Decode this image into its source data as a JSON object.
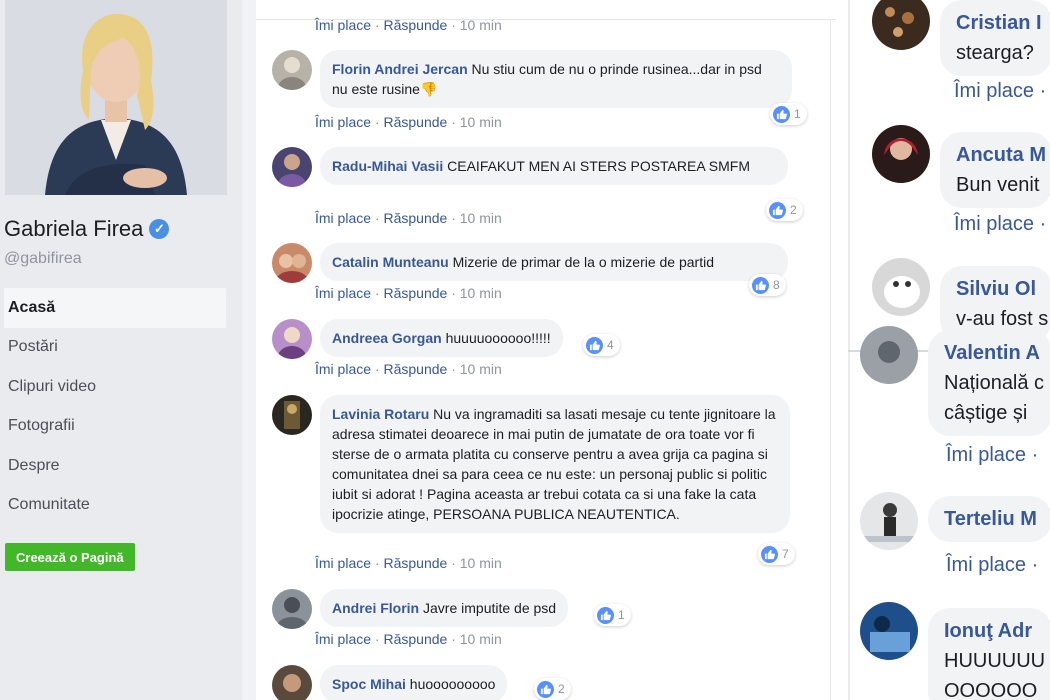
{
  "profile": {
    "name": "Gabriela Firea",
    "handle": "@gabifirea"
  },
  "nav": [
    {
      "label": "Acasă",
      "active": true
    },
    {
      "label": "Postări"
    },
    {
      "label": "Clipuri video"
    },
    {
      "label": "Fotografii"
    },
    {
      "label": "Despre"
    },
    {
      "label": "Comunitate"
    }
  ],
  "create_page_label": "Creează o Pagină",
  "actions": {
    "like": "Îmi place",
    "reply": "Răspunde",
    "sep": " · "
  },
  "top_action": {
    "time": "10 min"
  },
  "comments": [
    {
      "author": "Florin Andrei Jercan",
      "text": "Nu stiu cum de nu o prinde rusinea...dar in psd nu este rusine",
      "emoji": "👎",
      "time": "10 min",
      "likes": "1"
    },
    {
      "author": "Radu-Mihai Vasii",
      "text": "CEAIFAKUT MEN AI STERS POSTAREA SMFM",
      "time": "10 min",
      "likes": "2"
    },
    {
      "author": "Catalin Munteanu",
      "text": "Mizerie de primar de la o mizerie de partid",
      "time": "10 min",
      "likes": "8"
    },
    {
      "author": "Andreea Gorgan",
      "text": "huuuuoooooo!!!!!",
      "time": "10 min",
      "likes": "4"
    },
    {
      "author": "Lavinia Rotaru",
      "text": "Nu va ingramaditi sa lasati mesaje cu tente jignitoare la adresa stimatei deoarece in mai putin de jumatate de ora toate vor fi sterse de o armata platita cu conserve pentru a avea grija ca pagina si comunitatea dnei sa para ceea ce nu este: un personaj public si politic iubit si adorat ! Pagina aceasta ar trebui cotata ca si una fake la cata ipocrizie atinge, PERSOANA PUBLICA NEAUTENTICA.",
      "time": "10 min",
      "likes": "7"
    },
    {
      "author": "Andrei Florin",
      "text": "Javre imputite de psd",
      "time": "10 min",
      "likes": "1"
    },
    {
      "author": "Spoc Mihai",
      "text": "huooooooooo",
      "likes": "2"
    }
  ],
  "right_comments": [
    {
      "author": "Cristian I",
      "text": "stearga?",
      "action": "Îmi place ·"
    },
    {
      "author": "Ancuta M",
      "text": "Bun venit",
      "action": "Îmi place ·"
    },
    {
      "author": "Silviu Ol",
      "text": "v-au fost s"
    },
    {
      "author": "Valentin A",
      "line1": "Națională c",
      "line2": "câștige și",
      "action": "Îmi place ·"
    },
    {
      "author": "Terteliu M",
      "action": "Îmi place ·"
    },
    {
      "author": "Ionuţ Adr",
      "line1": "HUUUUUU",
      "line2": "OOOOOO"
    }
  ],
  "colors": {
    "link": "#385898",
    "like_blue": "#5890ff",
    "green_button": "#42b72a",
    "bubble_bg": "#f2f3f5"
  }
}
